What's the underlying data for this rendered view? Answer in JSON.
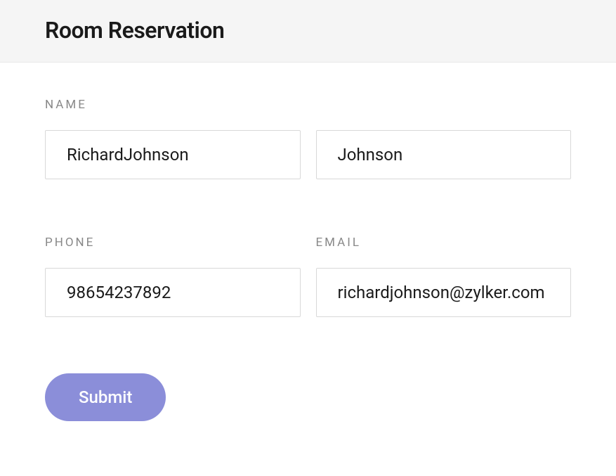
{
  "header": {
    "title": "Room Reservation"
  },
  "form": {
    "name_label": "NAME",
    "first_name_value": "RichardJohnson",
    "last_name_value": "Johnson",
    "phone_label": "PHONE",
    "phone_value": "98654237892",
    "email_label": "EMAIL",
    "email_value": "richardjohnson@zylker.com",
    "submit_label": "Submit"
  }
}
